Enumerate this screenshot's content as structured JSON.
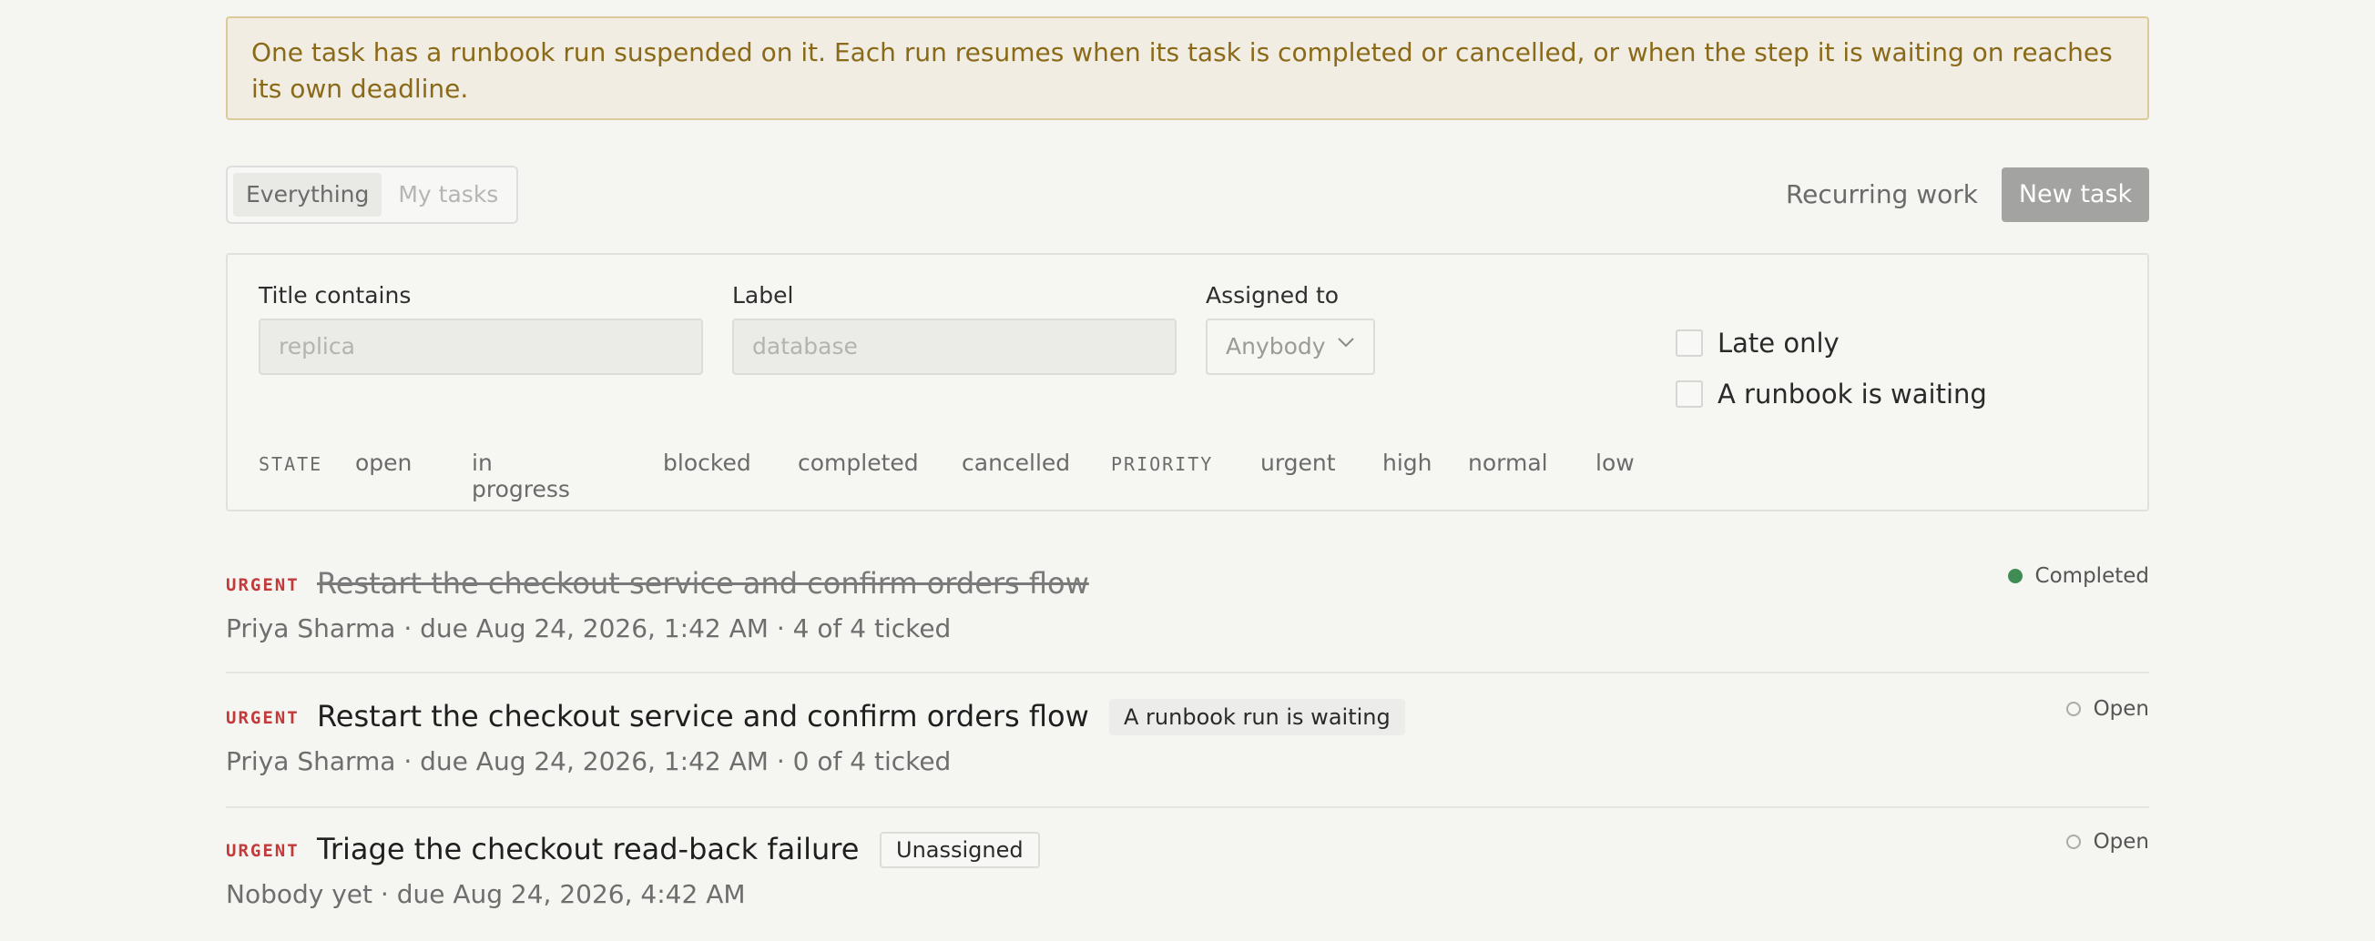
{
  "banner": {
    "line1": "One task has a runbook run suspended on it. Each run resumes when its task is completed or cancelled, or when the step it is waiting on reaches",
    "line2": "its own deadline."
  },
  "scope_tabs": [
    {
      "label": "Everything",
      "active": true
    },
    {
      "label": "My tasks",
      "active": false
    }
  ],
  "actions": {
    "recurring": "Recurring work",
    "new_task": "New task"
  },
  "filters": {
    "title_label": "Title contains",
    "title_placeholder": "replica",
    "label_label": "Label",
    "label_placeholder": "database",
    "assigned_label": "Assigned to",
    "assigned_value": "Anybody",
    "late_only": "Late only",
    "runbook_waiting": "A runbook is waiting",
    "state_heading": "STATE",
    "states": [
      "open",
      "in progress",
      "blocked",
      "completed",
      "cancelled"
    ],
    "priority_heading": "PRIORITY",
    "priorities": [
      "urgent",
      "high",
      "normal",
      "low"
    ]
  },
  "tasks": [
    {
      "priority": "URGENT",
      "title": "Restart the checkout service and confirm orders flow",
      "meta": "Priya Sharma · due Aug 24, 2026, 1:42 AM · 4 of 4 ticked",
      "status": "Completed",
      "tag": ""
    },
    {
      "priority": "URGENT",
      "title": "Restart the checkout service and confirm orders flow",
      "meta": "Priya Sharma · due Aug 24, 2026, 1:42 AM · 0 of 4 ticked",
      "status": "Open",
      "tag": "A runbook run is waiting"
    },
    {
      "priority": "URGENT",
      "title": "Triage the checkout read-back failure",
      "meta": "Nobody yet · due Aug 24, 2026, 4:42 AM",
      "status": "Open",
      "tag": "Unassigned"
    }
  ],
  "colors": {
    "banner_text": "#8a6a18",
    "urgent": "#c23a3a",
    "completed_dot": "#3f8c55"
  }
}
